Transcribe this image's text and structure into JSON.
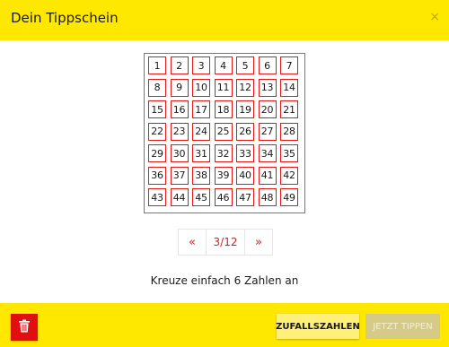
{
  "header": {
    "title": "Dein Tippschein",
    "close_symbol": "×"
  },
  "grid": {
    "numbers": [
      1,
      2,
      3,
      4,
      5,
      6,
      7,
      8,
      9,
      10,
      11,
      12,
      13,
      14,
      15,
      16,
      17,
      18,
      19,
      20,
      21,
      22,
      23,
      24,
      25,
      26,
      27,
      28,
      29,
      30,
      31,
      32,
      33,
      34,
      35,
      36,
      37,
      38,
      39,
      40,
      41,
      42,
      43,
      44,
      45,
      46,
      47,
      48,
      49
    ]
  },
  "pager": {
    "prev_label": "«",
    "page_label": "3/12",
    "next_label": "»"
  },
  "hint": {
    "text": "Kreuze einfach 6 Zahlen an"
  },
  "footer": {
    "trash_icon": "trash-icon",
    "random_label": "ZUFALLSZAHLEN",
    "submit_label": "JETZT TIPPEN"
  },
  "colors": {
    "brand_yellow": "#ffe800",
    "accent_red": "#e01818",
    "submit_disabled": "#d6ca88"
  }
}
